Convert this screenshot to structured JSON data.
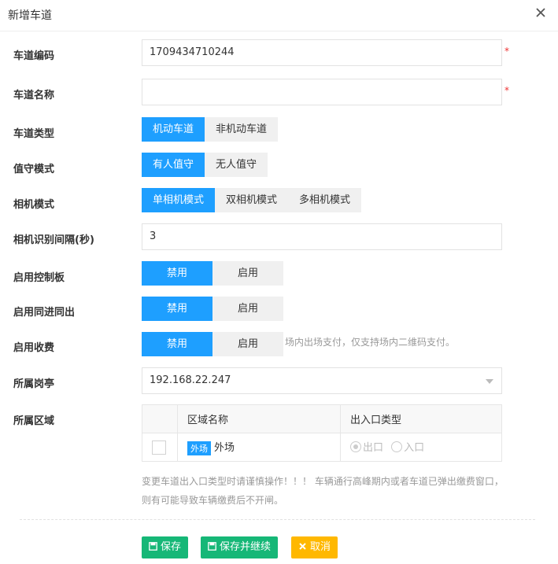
{
  "dialog": {
    "title": "新增车道"
  },
  "fields": {
    "lane_code": {
      "label": "车道编码",
      "value": "1709434710244",
      "required_mark": "*"
    },
    "lane_name": {
      "label": "车道名称",
      "value": "",
      "required_mark": "*"
    },
    "lane_type": {
      "label": "车道类型",
      "options": [
        "机动车道",
        "非机动车道"
      ],
      "selected": "机动车道"
    },
    "duty_mode": {
      "label": "值守模式",
      "options": [
        "有人值守",
        "无人值守"
      ],
      "selected": "有人值守"
    },
    "camera_mode": {
      "label": "相机模式",
      "options": [
        "单相机模式",
        "双相机模式",
        "多相机模式"
      ],
      "selected": "单相机模式"
    },
    "camera_interval": {
      "label": "相机识别间隔(秒)",
      "value": "3"
    },
    "control_board": {
      "label": "启用控制板",
      "options": [
        "禁用",
        "启用"
      ],
      "selected": "禁用"
    },
    "same_in_out": {
      "label": "启用同进同出",
      "options": [
        "禁用",
        "启用"
      ],
      "selected": "禁用"
    },
    "charging": {
      "label": "启用收费",
      "options": [
        "禁用",
        "启用"
      ],
      "selected": "禁用",
      "hint": "场内出场支付，仅支持场内二维码支付。"
    },
    "booth": {
      "label": "所属岗亭",
      "value": "192.168.22.247"
    },
    "region": {
      "label": "所属区域",
      "columns": [
        "区域名称",
        "出入口类型"
      ],
      "rows": [
        {
          "tag": "外场",
          "name": "外场",
          "io_options": [
            "出口",
            "入口"
          ],
          "io_selected": "出口"
        }
      ]
    }
  },
  "warning": "变更车道出入口类型时请谨慎操作！！！ 车辆通行高峰期内或者车道已弹出缴费窗口，则有可能导致车辆缴费后不开闸。",
  "buttons": {
    "save": "保存",
    "save_continue": "保存并继续",
    "cancel": "取消"
  },
  "colors": {
    "primary": "#1e9fff",
    "save": "#16b777",
    "cancel": "#ffb800",
    "required": "#e33333"
  }
}
